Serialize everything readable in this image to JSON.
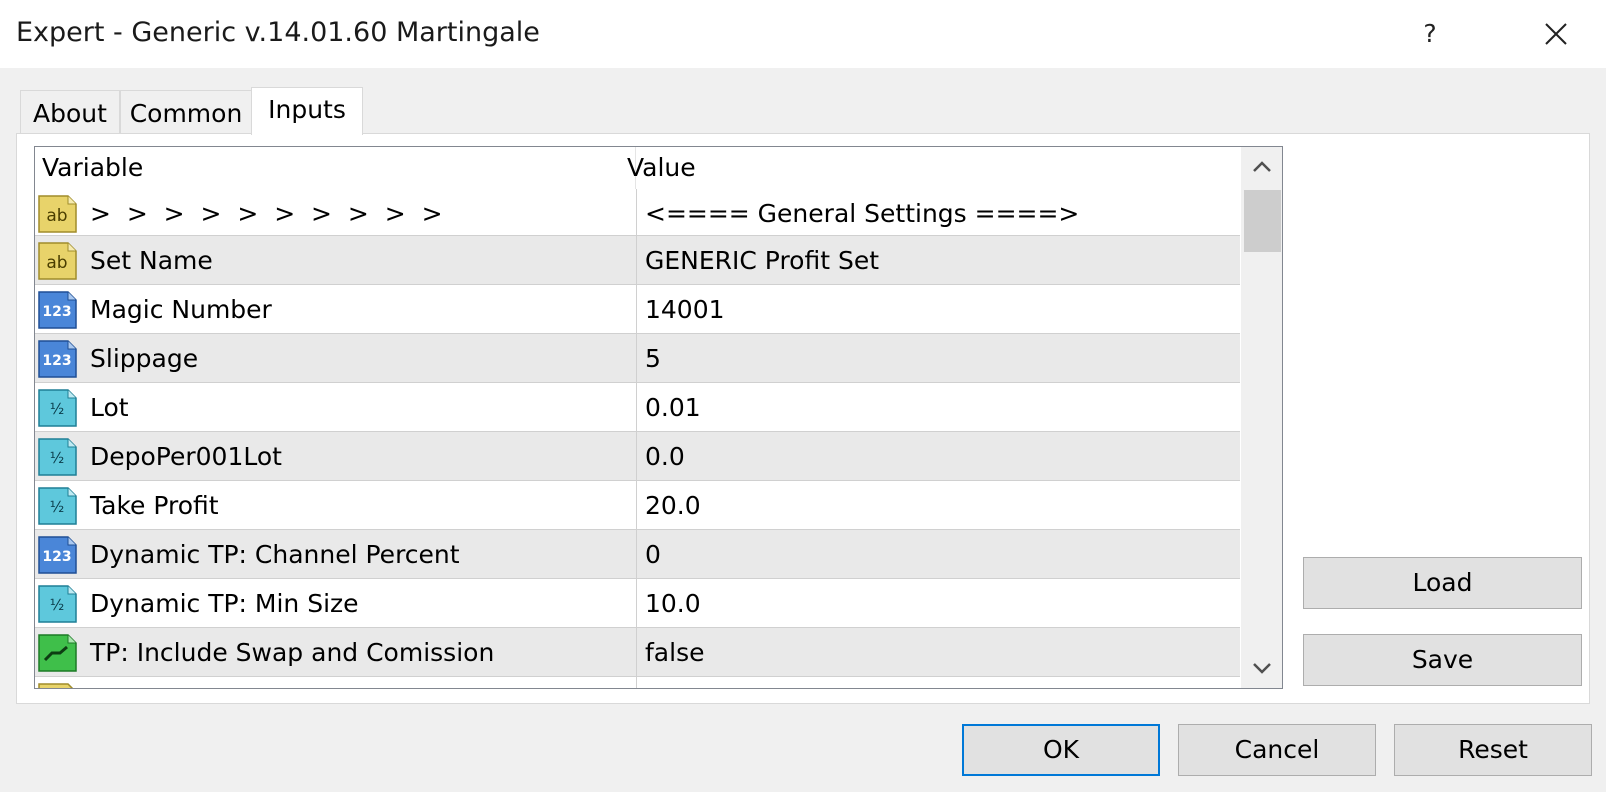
{
  "window": {
    "title": "Expert - Generic v.14.01.60 Martingale",
    "help_label": "?",
    "close_icon": "close-icon"
  },
  "tabs": [
    {
      "label": "About",
      "active": false
    },
    {
      "label": "Common",
      "active": false
    },
    {
      "label": "Inputs",
      "active": true
    }
  ],
  "grid": {
    "columns": {
      "variable": "Variable",
      "value": "Value"
    },
    "rows": [
      {
        "icon": "string-icon",
        "variable": ">  >  >  >  >  >  >  >  >  >",
        "value": "<==== General Settings ====>"
      },
      {
        "icon": "string-icon",
        "variable": "Set Name",
        "value": "GENERIC Profit Set"
      },
      {
        "icon": "integer-icon",
        "variable": "Magic Number",
        "value": "14001"
      },
      {
        "icon": "integer-icon",
        "variable": "Slippage",
        "value": "5"
      },
      {
        "icon": "double-icon",
        "variable": "Lot",
        "value": "0.01"
      },
      {
        "icon": "double-icon",
        "variable": "DepoPer001Lot",
        "value": "0.0"
      },
      {
        "icon": "double-icon",
        "variable": "Take Profit",
        "value": "20.0"
      },
      {
        "icon": "integer-icon",
        "variable": "Dynamic TP: Channel Percent",
        "value": "0"
      },
      {
        "icon": "double-icon",
        "variable": "Dynamic TP: Min Size",
        "value": "10.0"
      },
      {
        "icon": "bool-icon",
        "variable": "TP: Include Swap and Comission",
        "value": "false"
      },
      {
        "icon": "string-icon",
        "variable": "",
        "value": ""
      }
    ]
  },
  "side_buttons": {
    "load": "Load",
    "save": "Save"
  },
  "footer_buttons": {
    "ok": "OK",
    "cancel": "Cancel",
    "reset": "Reset"
  },
  "colors": {
    "string_icon": "#e8d36a",
    "integer_icon": "#4a86d8",
    "double_icon": "#5ec8dc",
    "bool_icon": "#3fbf4a",
    "accent": "#0078d7"
  }
}
